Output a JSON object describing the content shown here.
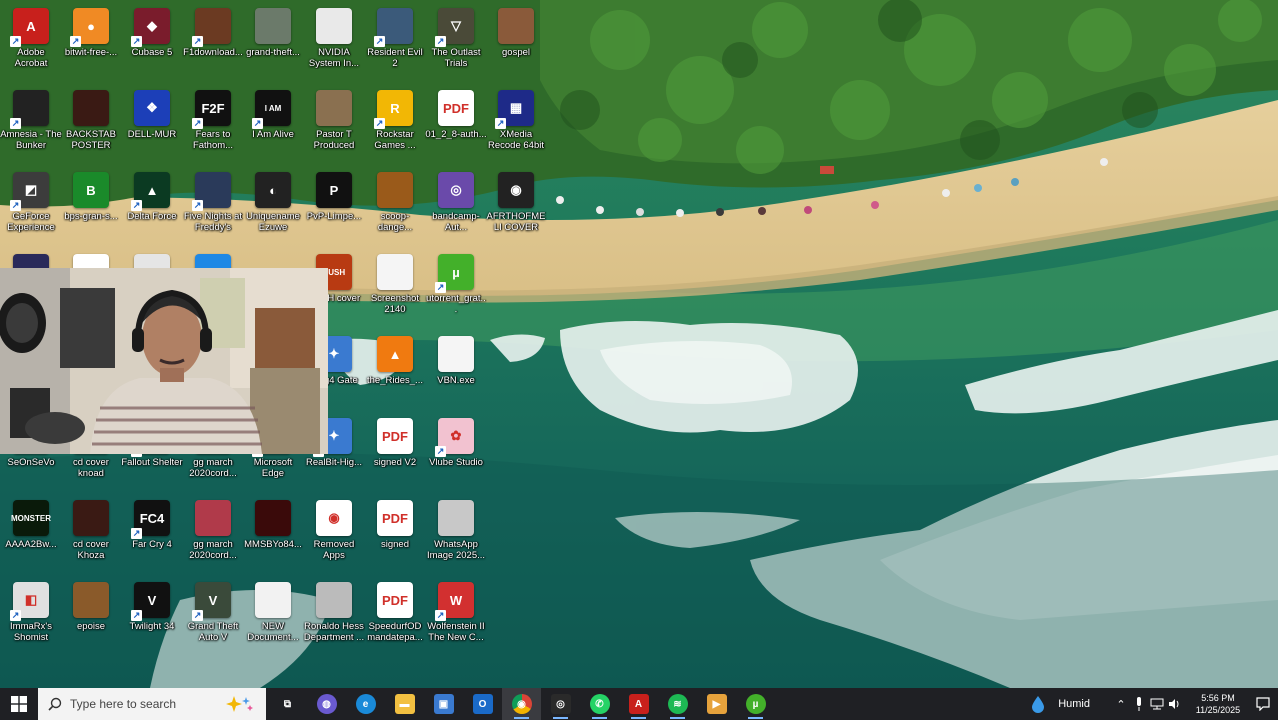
{
  "desktop": {
    "icons": [
      {
        "label": "Adobe Acrobat",
        "color": "#c8201c",
        "glyph": "A",
        "shortcut": true
      },
      {
        "label": "bitwit-free-...",
        "color": "#f08a24",
        "glyph": "●",
        "shortcut": true
      },
      {
        "label": "Cubase 5",
        "color": "#7a1c2c",
        "glyph": "◆",
        "shortcut": true
      },
      {
        "label": "F1download...",
        "color": "#6b3a22",
        "glyph": "",
        "shortcut": true
      },
      {
        "label": "grand-theft...",
        "color": "#6b7a6a",
        "glyph": "",
        "shortcut": false
      },
      {
        "label": "NVIDIA System In...",
        "color": "#e9e9e9",
        "glyph": "",
        "shortcut": false
      },
      {
        "label": "Resident Evil 2",
        "color": "#3b5a7a",
        "glyph": "",
        "shortcut": true
      },
      {
        "label": "The Outlast Trials",
        "color": "#4a4a38",
        "glyph": "▽",
        "shortcut": true
      },
      {
        "label": "gospel",
        "color": "#8a5a3a",
        "glyph": "",
        "shortcut": false
      },
      {
        "label": "Amnesia - The Bunker",
        "color": "#222",
        "glyph": "",
        "shortcut": true
      },
      {
        "label": "BACKSTAB POSTER",
        "color": "#3a1a14",
        "glyph": "",
        "shortcut": false
      },
      {
        "label": "DELL-MUR",
        "color": "#1c3fb8",
        "glyph": "❖",
        "shortcut": false
      },
      {
        "label": "Fears to Fathom...",
        "color": "#111",
        "glyph": "F2F",
        "shortcut": true
      },
      {
        "label": "I Am Alive",
        "color": "#111",
        "glyph": "I AM",
        "shortcut": true
      },
      {
        "label": "Pastor T Produced",
        "color": "#8a7050",
        "glyph": "",
        "shortcut": false
      },
      {
        "label": "Rockstar Games ...",
        "color": "#f2b705",
        "glyph": "R",
        "shortcut": true
      },
      {
        "label": "01_2_8-auth...",
        "color": "#ffffff",
        "glyph": "PDF",
        "shortcut": false
      },
      {
        "label": "XMedia Recode 64bit",
        "color": "#1e2a88",
        "glyph": "▦",
        "shortcut": true
      },
      {
        "label": "GeForce Experience",
        "color": "#3c3c3c",
        "glyph": "◩",
        "shortcut": true
      },
      {
        "label": "bps-gran-s...",
        "color": "#1a8a2a",
        "glyph": "B",
        "shortcut": false
      },
      {
        "label": "Delta Force",
        "color": "#0b3a22",
        "glyph": "▲",
        "shortcut": true
      },
      {
        "label": "Five Nights at Freddy's Into...",
        "color": "#2a3a5a",
        "glyph": "",
        "shortcut": true
      },
      {
        "label": "Uniquename Ezuwe",
        "color": "#222",
        "glyph": "◐",
        "shortcut": false
      },
      {
        "label": "PvP-Limpe...",
        "color": "#111",
        "glyph": "P",
        "shortcut": false
      },
      {
        "label": "scoop-dange...",
        "color": "#9a5a1a",
        "glyph": "",
        "shortcut": false
      },
      {
        "label": "bandcamp-Aut...",
        "color": "#6a4aaa",
        "glyph": "◎",
        "shortcut": false
      },
      {
        "label": "AFRTHOFMELI COVER",
        "color": "#222",
        "glyph": "◉",
        "shortcut": false
      },
      {
        "label": "",
        "color": "#2a2a5a",
        "glyph": "",
        "shortcut": false
      },
      {
        "label": "",
        "color": "#ffffff",
        "glyph": "",
        "shortcut": false
      },
      {
        "label": "",
        "color": "#e5e5e5",
        "glyph": "",
        "shortcut": false
      },
      {
        "label": "",
        "color": "#1e88e5",
        "glyph": "",
        "shortcut": false
      },
      {
        "label": "PUSH cover",
        "color": "#b83a12",
        "glyph": "PUSH",
        "shortcut": false
      },
      {
        "label": "Screenshot 2140",
        "color": "#f5f5f5",
        "glyph": "",
        "shortcut": false
      },
      {
        "label": "utorrent_grat...",
        "color": "#43b02a",
        "glyph": "µ",
        "shortcut": true
      },
      {
        "label": "Ping4 Gate",
        "color": "#3a7ad0",
        "glyph": "✦",
        "shortcut": true
      },
      {
        "label": "the_Rides_...",
        "color": "#f07a10",
        "glyph": "▲",
        "shortcut": false
      },
      {
        "label": "VBN.exe",
        "color": "#f5f5f5",
        "glyph": "",
        "shortcut": false
      },
      {
        "label": "",
        "color": "#ffffff",
        "glyph": "",
        "shortcut": false
      },
      {
        "label": "",
        "color": "#ffffff",
        "glyph": "",
        "shortcut": false
      },
      {
        "label": "",
        "color": "#ffffff",
        "glyph": "",
        "shortcut": false
      },
      {
        "label": "RealBit-Hig...",
        "color": "#3a7ad0",
        "glyph": "✦",
        "shortcut": true
      },
      {
        "label": "signed V2",
        "color": "#ffffff",
        "glyph": "PDF",
        "shortcut": false
      },
      {
        "label": "Vlube Studio",
        "color": "#f2c2d0",
        "glyph": "✿",
        "shortcut": true
      },
      {
        "label": "SeOnSeVo",
        "color": "#ffffff",
        "glyph": "",
        "shortcut": false
      },
      {
        "label": "cd cover knoad",
        "color": "#ffffff",
        "glyph": "",
        "shortcut": false
      },
      {
        "label": "Fallout Shelter",
        "color": "#ffffff",
        "glyph": "",
        "shortcut": true
      },
      {
        "label": "gg march 2020cord...",
        "color": "#ffffff",
        "glyph": "",
        "shortcut": false
      },
      {
        "label": "Microsoft Edge",
        "color": "#ffffff",
        "glyph": "",
        "shortcut": true
      },
      {
        "label": "AAAA2Bw...",
        "color": "#0a1a0a",
        "glyph": "MONSTER",
        "shortcut": false
      },
      {
        "label": "cd cover Khoza",
        "color": "#3a1a14",
        "glyph": "",
        "shortcut": false
      },
      {
        "label": "Far Cry 4",
        "color": "#111",
        "glyph": "FC4",
        "shortcut": true
      },
      {
        "label": "gg march 2020cord...",
        "color": "#b03a4a",
        "glyph": "",
        "shortcut": false
      },
      {
        "label": "MMSBYo84...",
        "color": "#3a0a0a",
        "glyph": "",
        "shortcut": false
      },
      {
        "label": "Removed Apps",
        "color": "#ffffff",
        "glyph": "◉",
        "shortcut": false
      },
      {
        "label": "signed",
        "color": "#ffffff",
        "glyph": "PDF",
        "shortcut": false
      },
      {
        "label": "WhatsApp Image 2025...",
        "color": "#c8c8c8",
        "glyph": "",
        "shortcut": false
      },
      {
        "label": "ImmaRx's Shomist",
        "color": "#e0e0e0",
        "glyph": "◧",
        "shortcut": true
      },
      {
        "label": "epoise",
        "color": "#8a5a2a",
        "glyph": "",
        "shortcut": false
      },
      {
        "label": "Twilight 34",
        "color": "#111",
        "glyph": "V",
        "shortcut": true
      },
      {
        "label": "Grand Theft Auto V",
        "color": "#3a4a3a",
        "glyph": "V",
        "shortcut": true
      },
      {
        "label": "NEW Document...",
        "color": "#f2f2f2",
        "glyph": "",
        "shortcut": false
      },
      {
        "label": "Ronaldo Hess Department ...",
        "color": "#bbb",
        "glyph": "",
        "shortcut": false
      },
      {
        "label": "SpeedurfOD mandatepa...",
        "color": "#ffffff",
        "glyph": "PDF",
        "shortcut": false
      },
      {
        "label": "Wolfenstein II The New C...",
        "color": "#d23030",
        "glyph": "W",
        "shortcut": true
      }
    ]
  },
  "taskbar": {
    "search_placeholder": "Type here to search",
    "apps": [
      {
        "name": "task-view",
        "color": "#1f2024",
        "glyph": "⧉"
      },
      {
        "name": "copilot",
        "color": "#6a5ad0",
        "glyph": "◍"
      },
      {
        "name": "edge",
        "color": "#1a8ad8",
        "glyph": "e"
      },
      {
        "name": "file-explorer",
        "color": "#f2c041",
        "glyph": "▬"
      },
      {
        "name": "microsoft-store",
        "color": "#3a7ad0",
        "glyph": "▣"
      },
      {
        "name": "outlook",
        "color": "#1a6ac8",
        "glyph": "O"
      },
      {
        "name": "chrome",
        "color": "#db4437",
        "glyph": "◉"
      },
      {
        "name": "obs-studio",
        "color": "#2a2a2a",
        "glyph": "◎"
      },
      {
        "name": "whatsapp",
        "color": "#25d366",
        "glyph": "✆"
      },
      {
        "name": "acrobat",
        "color": "#c8201c",
        "glyph": "A"
      },
      {
        "name": "spotify",
        "color": "#1db954",
        "glyph": "≋"
      },
      {
        "name": "media-player",
        "color": "#e6a23c",
        "glyph": "▶"
      },
      {
        "name": "utorrent",
        "color": "#43b02a",
        "glyph": "µ"
      }
    ],
    "weather_label": "Humid",
    "time": "5:56 PM",
    "date": "11/25/2025"
  }
}
